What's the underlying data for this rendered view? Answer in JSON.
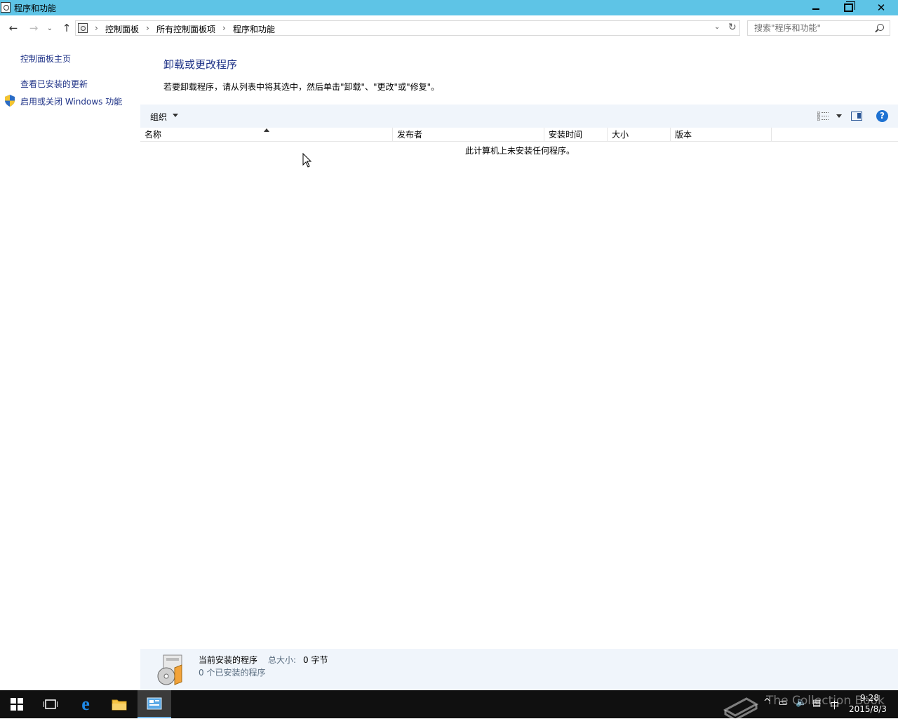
{
  "window": {
    "title": "程序和功能",
    "accent": "#5ec4e6"
  },
  "address": {
    "crumbs": [
      "控制面板",
      "所有控制面板项",
      "程序和功能"
    ],
    "separator": "›"
  },
  "search": {
    "placeholder": "搜索\"程序和功能\""
  },
  "sidebar": {
    "items": [
      {
        "label": "控制面板主页"
      },
      {
        "label": "查看已安装的更新"
      },
      {
        "label": "启用或关闭 Windows 功能",
        "icon": "uac-shield-icon"
      }
    ]
  },
  "main": {
    "title": "卸载或更改程序",
    "description": "若要卸载程序，请从列表中将其选中，然后单击\"卸载\"、\"更改\"或\"修复\"。",
    "toolbar": {
      "organize_label": "组织"
    },
    "columns": [
      "名称",
      "发布者",
      "安装时间",
      "大小",
      "版本"
    ],
    "empty_message": "此计算机上未安装任何程序。"
  },
  "details": {
    "title": "当前安装的程序",
    "size_label": "总大小:",
    "size_value": "0 字节",
    "count_text": "0 个已安装的程序"
  },
  "taskbar": {
    "time": "9:28",
    "date": "2015/8/3",
    "watermark": "The Collection Book"
  }
}
